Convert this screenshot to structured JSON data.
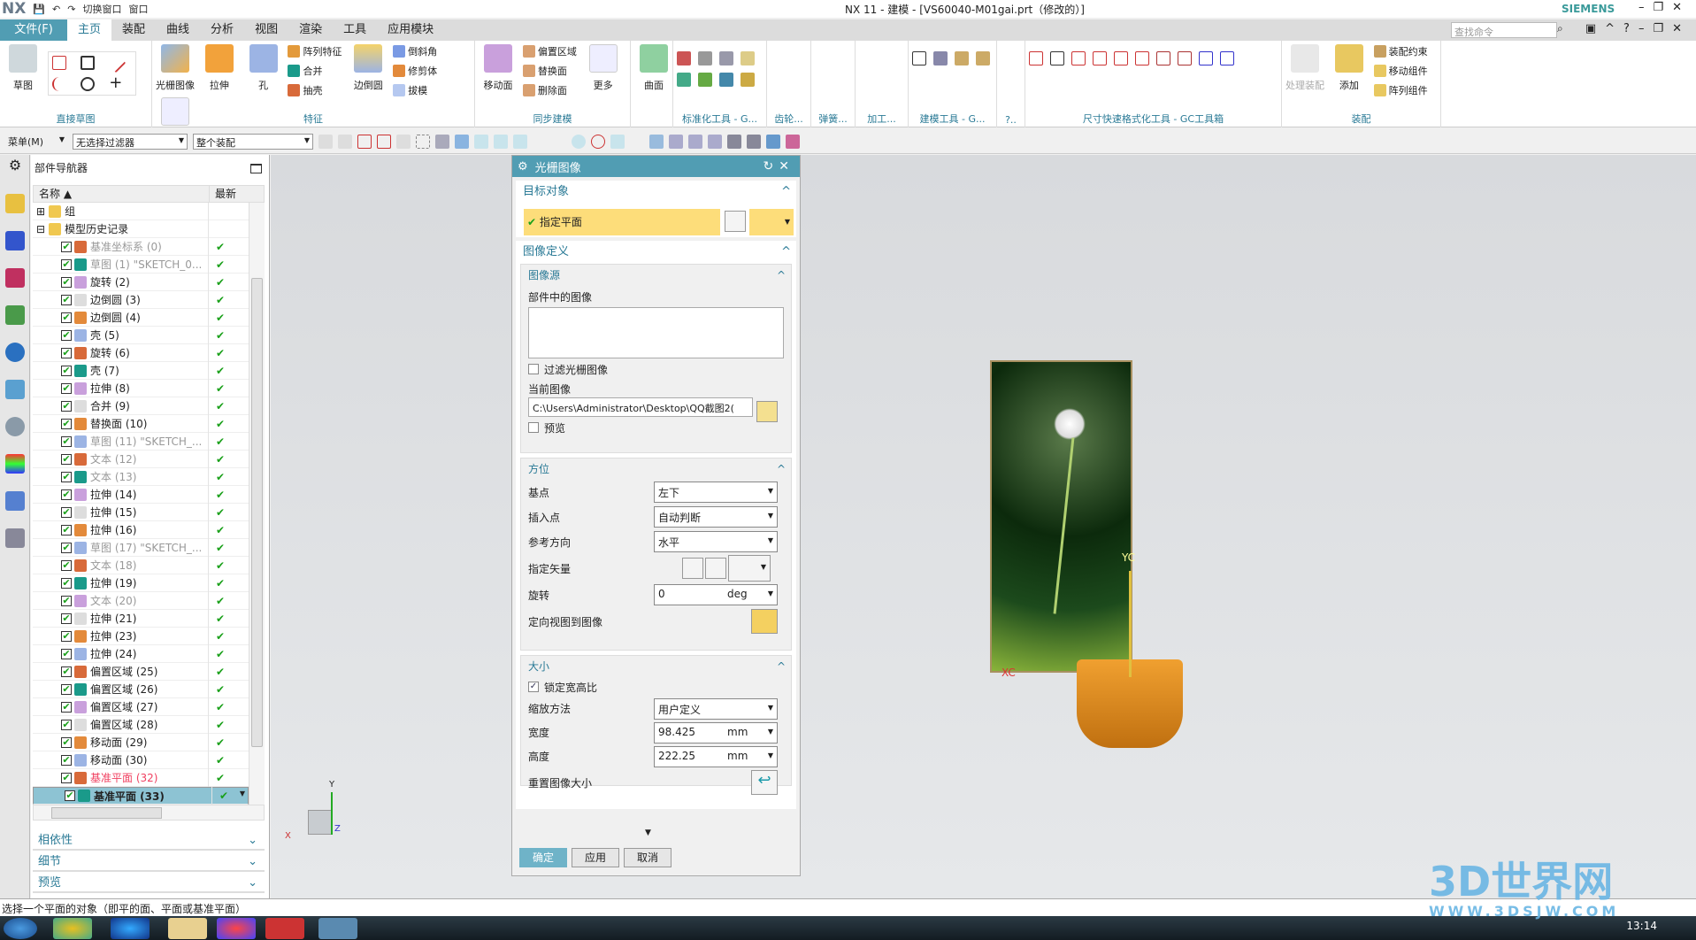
{
  "titlebar": {
    "logo": "NX",
    "quick": [
      "切换窗口",
      "窗口"
    ],
    "title": "NX 11 - 建模 - [VS60040-M01gai.prt（修改的）]",
    "brand": "SIEMENS"
  },
  "tabs": [
    {
      "label": "文件(F)"
    },
    {
      "label": "主页"
    },
    {
      "label": "装配"
    },
    {
      "label": "曲线"
    },
    {
      "label": "分析"
    },
    {
      "label": "视图"
    },
    {
      "label": "渲染"
    },
    {
      "label": "工具"
    },
    {
      "label": "应用模块"
    }
  ],
  "search": {
    "placeholder": "查找命令"
  },
  "ribbon": {
    "sketch": {
      "label": "直接草图",
      "btn": "草图"
    },
    "feature": {
      "label": "特征",
      "big": [
        "光栅图像",
        "拉伸",
        "孔"
      ],
      "small1": [
        "阵列特征",
        "合并",
        "抽壳"
      ],
      "big2": "边倒圆",
      "small2": [
        "倒斜角",
        "修剪体",
        "拔模"
      ],
      "more": "更多"
    },
    "sync": {
      "label": "同步建模",
      "big": "移动面",
      "small": [
        "偏置区域",
        "替换面",
        "删除面"
      ],
      "more": "更多"
    },
    "surface": {
      "btn": "曲面"
    },
    "groups": [
      "标准化工具 - G...",
      "齿轮...",
      "弹簧...",
      "加工...",
      "建模工具 - G...",
      "?..",
      "尺寸快速格式化工具 - GC工具箱"
    ],
    "assembly": {
      "label": "装配",
      "big": [
        "处理装配",
        "添加"
      ],
      "small": [
        "装配约束",
        "移动组件",
        "阵列组件"
      ]
    }
  },
  "toolbar2": {
    "menu": "菜单(M)",
    "filter": "无选择过滤器",
    "scope": "整个装配"
  },
  "nav": {
    "title": "部件导航器",
    "col_name": "名称",
    "col_latest": "最新",
    "items": [
      {
        "t": "组",
        "s": "",
        "c": "",
        "k": "folder"
      },
      {
        "t": "模型历史记录",
        "s": "",
        "c": "",
        "k": "folder"
      },
      {
        "t": "基准坐标系 (0)",
        "s": "✔",
        "c": "gray"
      },
      {
        "t": "草图 (1) \"SKETCH_0...",
        "s": "✔",
        "c": "gray"
      },
      {
        "t": "旋转 (2)",
        "s": "✔",
        "c": ""
      },
      {
        "t": "边倒圆 (3)",
        "s": "✔",
        "c": ""
      },
      {
        "t": "边倒圆 (4)",
        "s": "✔",
        "c": ""
      },
      {
        "t": "壳 (5)",
        "s": "✔",
        "c": ""
      },
      {
        "t": "旋转 (6)",
        "s": "✔",
        "c": ""
      },
      {
        "t": "壳 (7)",
        "s": "✔",
        "c": ""
      },
      {
        "t": "拉伸 (8)",
        "s": "✔",
        "c": ""
      },
      {
        "t": "合并 (9)",
        "s": "✔",
        "c": ""
      },
      {
        "t": "替换面 (10)",
        "s": "✔",
        "c": ""
      },
      {
        "t": "草图 (11) \"SKETCH_...",
        "s": "✔",
        "c": "gray"
      },
      {
        "t": "文本 (12)",
        "s": "✔",
        "c": "gray"
      },
      {
        "t": "文本 (13)",
        "s": "✔",
        "c": "gray"
      },
      {
        "t": "拉伸 (14)",
        "s": "✔",
        "c": ""
      },
      {
        "t": "拉伸 (15)",
        "s": "✔",
        "c": ""
      },
      {
        "t": "拉伸 (16)",
        "s": "✔",
        "c": ""
      },
      {
        "t": "草图 (17) \"SKETCH_...",
        "s": "✔",
        "c": "gray"
      },
      {
        "t": "文本 (18)",
        "s": "✔",
        "c": "gray"
      },
      {
        "t": "拉伸 (19)",
        "s": "✔",
        "c": ""
      },
      {
        "t": "文本 (20)",
        "s": "✔",
        "c": "gray"
      },
      {
        "t": "拉伸 (21)",
        "s": "✔",
        "c": ""
      },
      {
        "t": "拉伸 (23)",
        "s": "✔",
        "c": ""
      },
      {
        "t": "拉伸 (24)",
        "s": "✔",
        "c": ""
      },
      {
        "t": "偏置区域 (25)",
        "s": "✔",
        "c": ""
      },
      {
        "t": "偏置区域 (26)",
        "s": "✔",
        "c": ""
      },
      {
        "t": "偏置区域 (27)",
        "s": "✔",
        "c": ""
      },
      {
        "t": "偏置区域 (28)",
        "s": "✔",
        "c": ""
      },
      {
        "t": "移动面 (29)",
        "s": "✔",
        "c": ""
      },
      {
        "t": "移动面 (30)",
        "s": "✔",
        "c": ""
      },
      {
        "t": "基准平面 (32)",
        "s": "✔",
        "c": "red"
      },
      {
        "t": "基准平面 (33)",
        "s": "✔",
        "c": "selected"
      }
    ],
    "panels": [
      "相依性",
      "细节",
      "预览"
    ]
  },
  "dialog": {
    "title": "光栅图像",
    "target": {
      "title": "目标对象",
      "select": "指定平面"
    },
    "image_def": {
      "title": "图像定义",
      "source": {
        "title": "图像源",
        "in_part": "部件中的图像",
        "filter": "过滤光栅图像",
        "filter_checked": false,
        "current": "当前图像",
        "path": "C:\\Users\\Administrator\\Desktop\\QQ截图2(",
        "preview": "预览",
        "preview_checked": false
      }
    },
    "orient": {
      "title": "方位",
      "base_label": "基点",
      "base": "左下",
      "insert_label": "插入点",
      "insert": "自动判断",
      "ref_label": "参考方向",
      "ref": "水平",
      "vector_label": "指定矢量",
      "rot_label": "旋转",
      "rot": "0",
      "rot_unit": "deg",
      "orient_view": "定向视图到图像"
    },
    "size": {
      "title": "大小",
      "lock": "锁定宽高比",
      "lock_checked": true,
      "scale_label": "缩放方法",
      "scale": "用户定义",
      "w_label": "宽度",
      "w": "98.425",
      "w_unit": "mm",
      "h_label": "高度",
      "h": "222.25",
      "h_unit": "mm",
      "reset": "重置图像大小"
    },
    "ok": "确定",
    "apply": "应用",
    "cancel": "取消"
  },
  "viewport": {
    "axis_x": "X",
    "axis_y": "Y",
    "axis_z": "Z",
    "yc": "YC",
    "xc": "XC"
  },
  "status": "选择一个平面的对象（即平的面、平面或基准平面）",
  "taskbar": {
    "time": "13:14"
  },
  "watermark": {
    "name": "3D世界网",
    "url": "WWW.3DSJW.COM"
  },
  "colors": {
    "accent": "#519db3",
    "ok": "#1aa01a",
    "highlight": "#fddd7a"
  }
}
